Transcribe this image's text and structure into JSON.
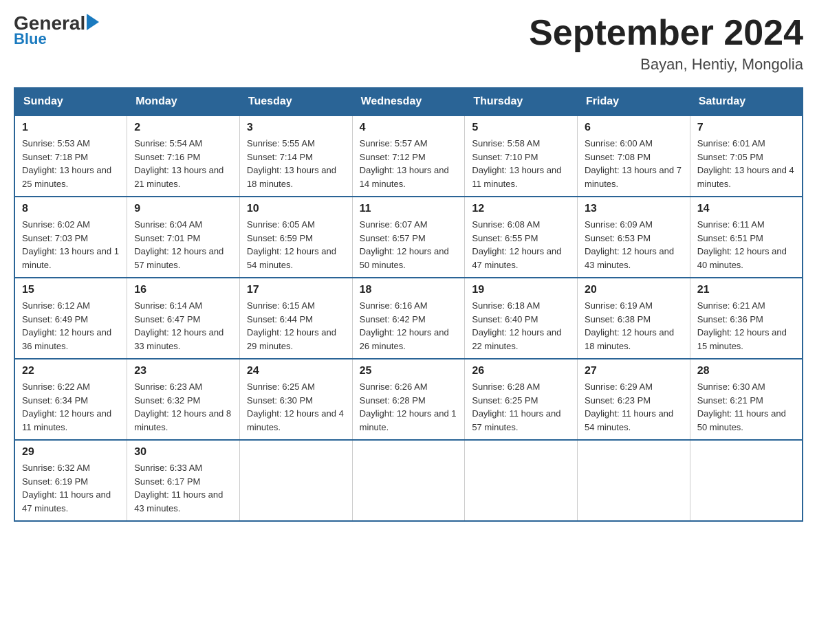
{
  "header": {
    "logo_general": "General",
    "logo_blue": "Blue",
    "month_title": "September 2024",
    "location": "Bayan, Hentiy, Mongolia"
  },
  "weekdays": [
    "Sunday",
    "Monday",
    "Tuesday",
    "Wednesday",
    "Thursday",
    "Friday",
    "Saturday"
  ],
  "rows": [
    [
      {
        "day": "1",
        "sunrise": "5:53 AM",
        "sunset": "7:18 PM",
        "daylight": "13 hours and 25 minutes."
      },
      {
        "day": "2",
        "sunrise": "5:54 AM",
        "sunset": "7:16 PM",
        "daylight": "13 hours and 21 minutes."
      },
      {
        "day": "3",
        "sunrise": "5:55 AM",
        "sunset": "7:14 PM",
        "daylight": "13 hours and 18 minutes."
      },
      {
        "day": "4",
        "sunrise": "5:57 AM",
        "sunset": "7:12 PM",
        "daylight": "13 hours and 14 minutes."
      },
      {
        "day": "5",
        "sunrise": "5:58 AM",
        "sunset": "7:10 PM",
        "daylight": "13 hours and 11 minutes."
      },
      {
        "day": "6",
        "sunrise": "6:00 AM",
        "sunset": "7:08 PM",
        "daylight": "13 hours and 7 minutes."
      },
      {
        "day": "7",
        "sunrise": "6:01 AM",
        "sunset": "7:05 PM",
        "daylight": "13 hours and 4 minutes."
      }
    ],
    [
      {
        "day": "8",
        "sunrise": "6:02 AM",
        "sunset": "7:03 PM",
        "daylight": "13 hours and 1 minute."
      },
      {
        "day": "9",
        "sunrise": "6:04 AM",
        "sunset": "7:01 PM",
        "daylight": "12 hours and 57 minutes."
      },
      {
        "day": "10",
        "sunrise": "6:05 AM",
        "sunset": "6:59 PM",
        "daylight": "12 hours and 54 minutes."
      },
      {
        "day": "11",
        "sunrise": "6:07 AM",
        "sunset": "6:57 PM",
        "daylight": "12 hours and 50 minutes."
      },
      {
        "day": "12",
        "sunrise": "6:08 AM",
        "sunset": "6:55 PM",
        "daylight": "12 hours and 47 minutes."
      },
      {
        "day": "13",
        "sunrise": "6:09 AM",
        "sunset": "6:53 PM",
        "daylight": "12 hours and 43 minutes."
      },
      {
        "day": "14",
        "sunrise": "6:11 AM",
        "sunset": "6:51 PM",
        "daylight": "12 hours and 40 minutes."
      }
    ],
    [
      {
        "day": "15",
        "sunrise": "6:12 AM",
        "sunset": "6:49 PM",
        "daylight": "12 hours and 36 minutes."
      },
      {
        "day": "16",
        "sunrise": "6:14 AM",
        "sunset": "6:47 PM",
        "daylight": "12 hours and 33 minutes."
      },
      {
        "day": "17",
        "sunrise": "6:15 AM",
        "sunset": "6:44 PM",
        "daylight": "12 hours and 29 minutes."
      },
      {
        "day": "18",
        "sunrise": "6:16 AM",
        "sunset": "6:42 PM",
        "daylight": "12 hours and 26 minutes."
      },
      {
        "day": "19",
        "sunrise": "6:18 AM",
        "sunset": "6:40 PM",
        "daylight": "12 hours and 22 minutes."
      },
      {
        "day": "20",
        "sunrise": "6:19 AM",
        "sunset": "6:38 PM",
        "daylight": "12 hours and 18 minutes."
      },
      {
        "day": "21",
        "sunrise": "6:21 AM",
        "sunset": "6:36 PM",
        "daylight": "12 hours and 15 minutes."
      }
    ],
    [
      {
        "day": "22",
        "sunrise": "6:22 AM",
        "sunset": "6:34 PM",
        "daylight": "12 hours and 11 minutes."
      },
      {
        "day": "23",
        "sunrise": "6:23 AM",
        "sunset": "6:32 PM",
        "daylight": "12 hours and 8 minutes."
      },
      {
        "day": "24",
        "sunrise": "6:25 AM",
        "sunset": "6:30 PM",
        "daylight": "12 hours and 4 minutes."
      },
      {
        "day": "25",
        "sunrise": "6:26 AM",
        "sunset": "6:28 PM",
        "daylight": "12 hours and 1 minute."
      },
      {
        "day": "26",
        "sunrise": "6:28 AM",
        "sunset": "6:25 PM",
        "daylight": "11 hours and 57 minutes."
      },
      {
        "day": "27",
        "sunrise": "6:29 AM",
        "sunset": "6:23 PM",
        "daylight": "11 hours and 54 minutes."
      },
      {
        "day": "28",
        "sunrise": "6:30 AM",
        "sunset": "6:21 PM",
        "daylight": "11 hours and 50 minutes."
      }
    ],
    [
      {
        "day": "29",
        "sunrise": "6:32 AM",
        "sunset": "6:19 PM",
        "daylight": "11 hours and 47 minutes."
      },
      {
        "day": "30",
        "sunrise": "6:33 AM",
        "sunset": "6:17 PM",
        "daylight": "11 hours and 43 minutes."
      },
      null,
      null,
      null,
      null,
      null
    ]
  ]
}
